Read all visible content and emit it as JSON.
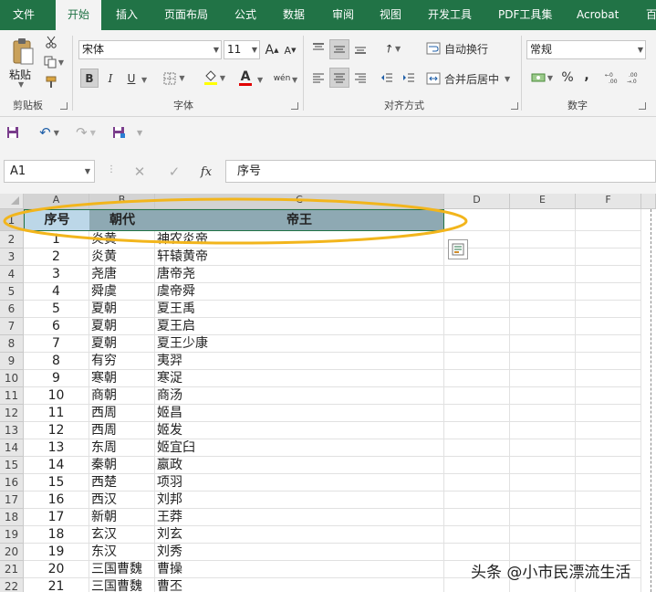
{
  "ribbon_tabs": [
    "文件",
    "开始",
    "插入",
    "页面布局",
    "公式",
    "数据",
    "审阅",
    "视图",
    "开发工具",
    "PDF工具集",
    "Acrobat",
    "百"
  ],
  "active_tab": "开始",
  "clipboard": {
    "paste_label": "粘贴",
    "group_label": "剪贴板"
  },
  "font": {
    "name": "宋体",
    "size": "11",
    "bold": "B",
    "italic": "I",
    "underline": "U",
    "grow": "A",
    "shrink": "A",
    "color_letter": "A",
    "phonetic": "wén",
    "group_label": "字体"
  },
  "alignment": {
    "wrap_label": "自动换行",
    "merge_label": "合并后居中",
    "group_label": "对齐方式"
  },
  "number": {
    "format": "常规",
    "percent": "%",
    "comma": ",",
    "group_label": "数字"
  },
  "name_box": "A1",
  "formula": "序号",
  "fx_label": "fx",
  "columns": [
    "A",
    "B",
    "C",
    "D",
    "E",
    "F"
  ],
  "header_row": {
    "a": "序号",
    "b": "朝代",
    "c": "帝王"
  },
  "rows": [
    {
      "r": "1"
    },
    {
      "r": "2",
      "a": "1",
      "b": "炎黄",
      "c": "神农炎帝"
    },
    {
      "r": "3",
      "a": "2",
      "b": "炎黄",
      "c": "轩辕黄帝"
    },
    {
      "r": "4",
      "a": "3",
      "b": "尧唐",
      "c": "唐帝尧"
    },
    {
      "r": "5",
      "a": "4",
      "b": "舜虞",
      "c": "虞帝舜"
    },
    {
      "r": "6",
      "a": "5",
      "b": "夏朝",
      "c": "夏王禹"
    },
    {
      "r": "7",
      "a": "6",
      "b": "夏朝",
      "c": "夏王启"
    },
    {
      "r": "8",
      "a": "7",
      "b": "夏朝",
      "c": "夏王少康"
    },
    {
      "r": "9",
      "a": "8",
      "b": "有穷",
      "c": "夷羿"
    },
    {
      "r": "10",
      "a": "9",
      "b": "寒朝",
      "c": "寒浞"
    },
    {
      "r": "11",
      "a": "10",
      "b": "商朝",
      "c": "商汤"
    },
    {
      "r": "12",
      "a": "11",
      "b": "西周",
      "c": "姬昌"
    },
    {
      "r": "13",
      "a": "12",
      "b": "西周",
      "c": "姬发"
    },
    {
      "r": "14",
      "a": "13",
      "b": "东周",
      "c": "姬宜臼"
    },
    {
      "r": "15",
      "a": "14",
      "b": "秦朝",
      "c": "嬴政"
    },
    {
      "r": "16",
      "a": "15",
      "b": "西楚",
      "c": "项羽"
    },
    {
      "r": "17",
      "a": "16",
      "b": "西汉",
      "c": "刘邦"
    },
    {
      "r": "18",
      "a": "17",
      "b": "新朝",
      "c": "王莽"
    },
    {
      "r": "19",
      "a": "18",
      "b": "玄汉",
      "c": "刘玄"
    },
    {
      "r": "20",
      "a": "19",
      "b": "东汉",
      "c": "刘秀"
    },
    {
      "r": "21",
      "a": "20",
      "b": "三国曹魏",
      "c": "曹操"
    },
    {
      "r": "22",
      "a": "21",
      "b": "三国曹魏",
      "c": "曹丕"
    }
  ],
  "watermark": "头条 @小市民漂流生活",
  "colors": {
    "ribbon_green": "#217346",
    "header_a_fill": "#bcd7e8",
    "header_bc_fill": "#8ea9b3",
    "highlight_ellipse": "#f2b51c"
  }
}
